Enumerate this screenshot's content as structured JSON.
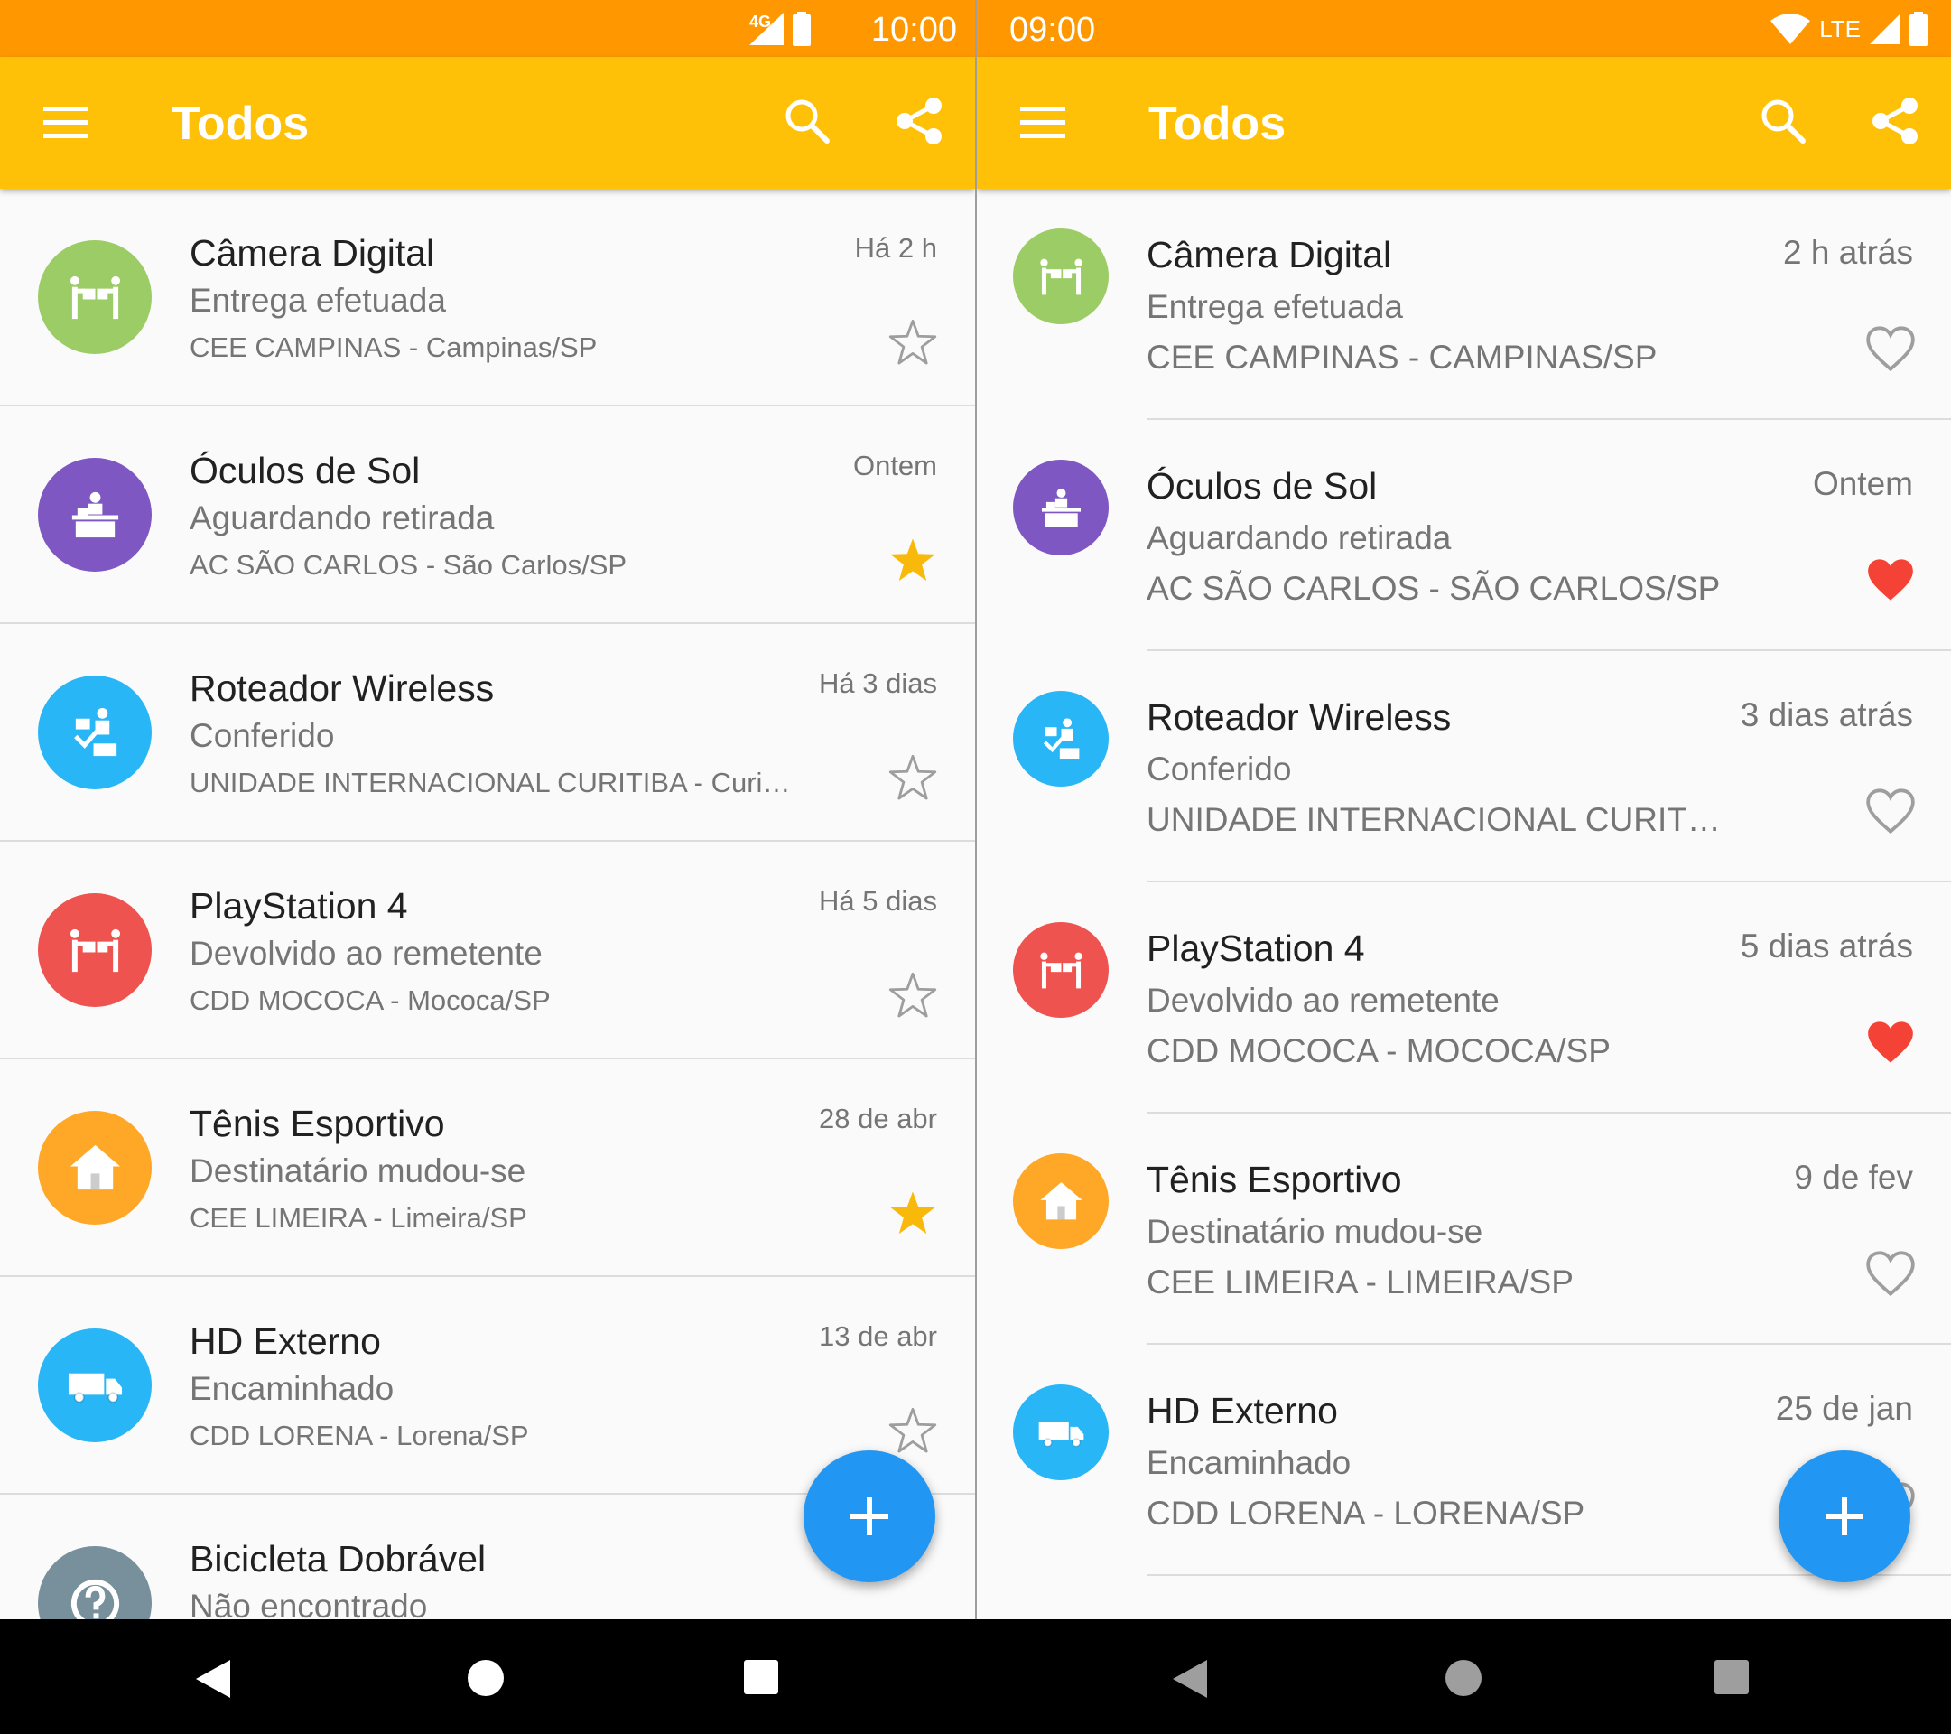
{
  "colors": {
    "status_bar": "#ff9800",
    "app_bar": "#ffc107",
    "fab": "#2196f3",
    "star_filled": "#f9b90a",
    "heart_filled": "#f44336",
    "outline": "#9e9e9e"
  },
  "left": {
    "status": {
      "network": "4G",
      "time": "10:00"
    },
    "app_bar": {
      "title": "Todos"
    },
    "items": [
      {
        "title": "Câmera Digital",
        "status": "Entrega efetuada",
        "location": "CEE CAMPINAS - Campinas/SP",
        "time": "Há 2 h",
        "favorite": false,
        "color": "#9ccc65",
        "icon": "hand-delivery-icon"
      },
      {
        "title": "Óculos de Sol",
        "status": "Aguardando retirada",
        "location": "AC SÃO CARLOS - São Carlos/SP",
        "time": "Ontem",
        "favorite": true,
        "color": "#7e57c2",
        "icon": "pickup-counter-icon"
      },
      {
        "title": "Roteador Wireless",
        "status": "Conferido",
        "location": "UNIDADE INTERNACIONAL CURITIBA - Curitiba/PR",
        "time": "Há 3 dias",
        "favorite": false,
        "color": "#29b6f6",
        "icon": "inspection-icon"
      },
      {
        "title": "PlayStation 4",
        "status": "Devolvido ao remetente",
        "location": "CDD MOCOCA - Mococa/SP",
        "time": "Há 5 dias",
        "favorite": false,
        "color": "#ef5350",
        "icon": "returned-icon"
      },
      {
        "title": "Tênis Esportivo",
        "status": "Destinatário mudou-se",
        "location": "CEE LIMEIRA - Limeira/SP",
        "time": "28 de abr",
        "favorite": true,
        "color": "#ffa726",
        "icon": "house-moved-icon"
      },
      {
        "title": "HD Externo",
        "status": "Encaminhado",
        "location": "CDD LORENA - Lorena/SP",
        "time": "13 de abr",
        "favorite": false,
        "color": "#29b6f6",
        "icon": "truck-icon"
      },
      {
        "title": "Bicicleta Dobrável",
        "status": "Não encontrado",
        "location": "",
        "time": "",
        "favorite": false,
        "color": "#78909c",
        "icon": "question-icon"
      }
    ]
  },
  "right": {
    "status": {
      "time": "09:00",
      "network": "LTE"
    },
    "app_bar": {
      "title": "Todos"
    },
    "items": [
      {
        "title": "Câmera Digital",
        "status": "Entrega efetuada",
        "location": "CEE CAMPINAS - CAMPINAS/SP",
        "time": "2 h atrás",
        "favorite": false,
        "color": "#9ccc65",
        "icon": "hand-delivery-icon"
      },
      {
        "title": "Óculos de Sol",
        "status": "Aguardando retirada",
        "location": "AC SÃO CARLOS - SÃO CARLOS/SP",
        "time": "Ontem",
        "favorite": true,
        "color": "#7e57c2",
        "icon": "pickup-counter-icon"
      },
      {
        "title": "Roteador Wireless",
        "status": "Conferido",
        "location": "UNIDADE INTERNACIONAL CURITIBA - CURITIBA/PR",
        "time": "3 dias atrás",
        "favorite": false,
        "color": "#29b6f6",
        "icon": "inspection-icon"
      },
      {
        "title": "PlayStation 4",
        "status": "Devolvido ao remetente",
        "location": "CDD MOCOCA - MOCOCA/SP",
        "time": "5 dias atrás",
        "favorite": true,
        "color": "#ef5350",
        "icon": "returned-icon"
      },
      {
        "title": "Tênis Esportivo",
        "status": "Destinatário mudou-se",
        "location": "CEE LIMEIRA - LIMEIRA/SP",
        "time": "9 de fev",
        "favorite": false,
        "color": "#ffa726",
        "icon": "house-moved-icon"
      },
      {
        "title": "HD Externo",
        "status": "Encaminhado",
        "location": "CDD LORENA - LORENA/SP",
        "time": "25 de jan",
        "favorite": false,
        "color": "#29b6f6",
        "icon": "truck-icon"
      }
    ]
  }
}
